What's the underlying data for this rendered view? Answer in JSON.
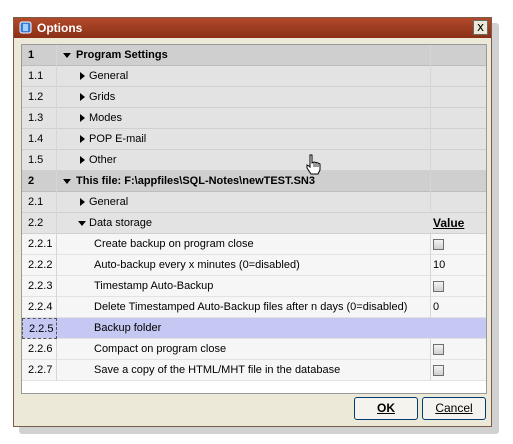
{
  "window": {
    "title": "Options",
    "close": "x"
  },
  "grid": {
    "value_header": "Value",
    "rows": [
      {
        "num": "1",
        "label": "Program Settings"
      },
      {
        "num": "1.1",
        "label": "General"
      },
      {
        "num": "1.2",
        "label": "Grids"
      },
      {
        "num": "1.3",
        "label": "Modes"
      },
      {
        "num": "1.4",
        "label": "POP E-mail"
      },
      {
        "num": "1.5",
        "label": "Other"
      },
      {
        "num": "2",
        "label": "This file: F:\\appfiles\\SQL-Notes\\newTEST.SN3"
      },
      {
        "num": "2.1",
        "label": "General"
      },
      {
        "num": "2.2",
        "label": "Data storage"
      },
      {
        "num": "2.2.1",
        "label": "Create backup on program close"
      },
      {
        "num": "2.2.2",
        "label": "Auto-backup every x minutes (0=disabled)",
        "value": "10"
      },
      {
        "num": "2.2.3",
        "label": "Timestamp Auto-Backup"
      },
      {
        "num": "2.2.4",
        "label": "Delete Timestamped Auto-Backup files after n days (0=disabled)",
        "value": "0"
      },
      {
        "num": "2.2.5",
        "label": "Backup folder"
      },
      {
        "num": "2.2.6",
        "label": "Compact on program close"
      },
      {
        "num": "2.2.7",
        "label": "Save a copy of the HTML/MHT file in the database"
      }
    ]
  },
  "buttons": {
    "ok": "OK",
    "cancel": "Cancel"
  },
  "colors": {
    "titlebar": "#9b3a1f",
    "selected_row": "#c5c8f2",
    "category_row": "#cfcfcf"
  }
}
